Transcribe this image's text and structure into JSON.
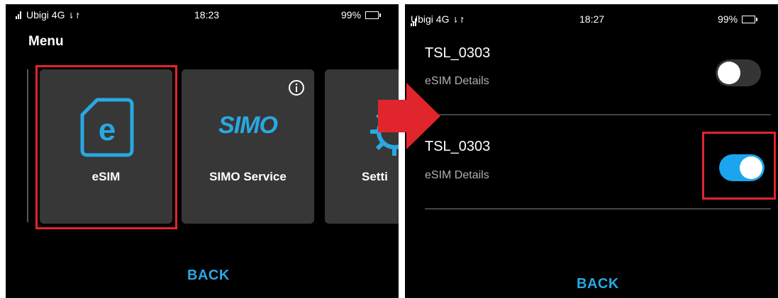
{
  "left_screen": {
    "status": {
      "carrier": "Ubigi 4G",
      "time": "18:23",
      "battery": "99%"
    },
    "title": "Menu",
    "tiles": [
      {
        "label": "eSIM",
        "logo": "e",
        "icon": "sim-card-icon"
      },
      {
        "label": "SIMO Service",
        "logo": "SIMO",
        "icon": "simo-logo-icon",
        "info_icon": "info-icon"
      },
      {
        "label": "Setti",
        "icon": "gear-icon"
      }
    ],
    "back_label": "BACK"
  },
  "right_screen": {
    "status": {
      "carrier": "Ubigi 4G",
      "time": "18:27",
      "battery": "99%"
    },
    "profiles": [
      {
        "name": "TSL_0303",
        "subtitle": "eSIM Details",
        "enabled": false
      },
      {
        "name": "TSL_0303",
        "subtitle": "eSIM Details",
        "enabled": true
      }
    ],
    "back_label": "BACK"
  },
  "colors": {
    "accent": "#29a8e2",
    "toggle_on": "#1aa5ee",
    "highlight": "#e1252c",
    "arrow": "#e1252c"
  }
}
